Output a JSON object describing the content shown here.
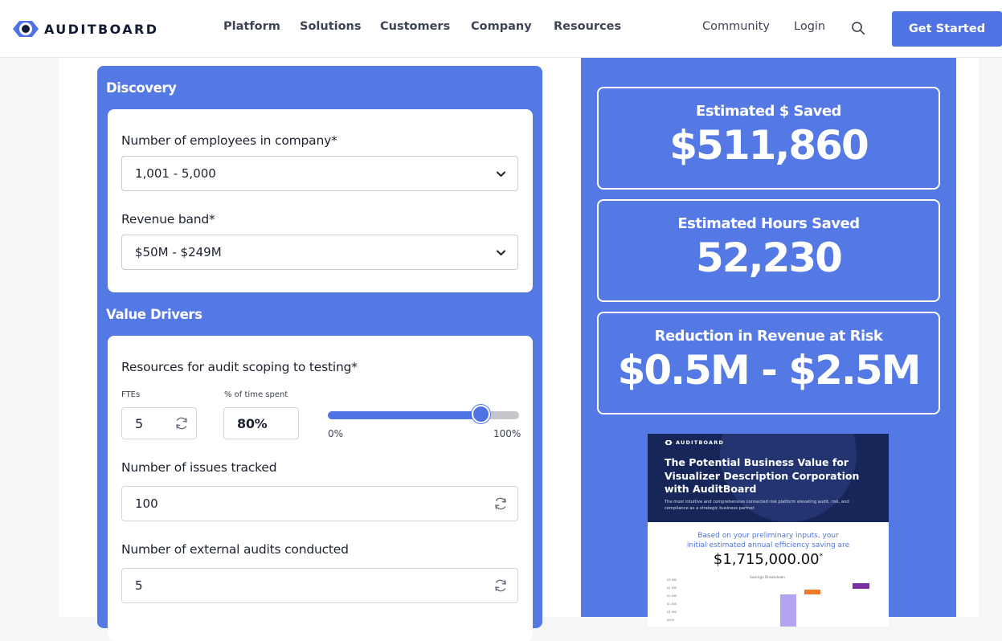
{
  "nav": {
    "logo_text": "AUDITBOARD",
    "links": [
      "Platform",
      "Solutions",
      "Customers",
      "Company",
      "Resources"
    ],
    "community": "Community",
    "login": "Login",
    "cta": "Get Started",
    "brand_color": "#4f73e3"
  },
  "discovery": {
    "title": "Discovery",
    "employees_label": "Number of employees in company*",
    "employees_value": "1,001 - 5,000",
    "revenue_label": "Revenue band*",
    "revenue_value": "$50M - $249M"
  },
  "value_drivers": {
    "title": "Value Drivers",
    "resources_label": "Resources for audit scoping to testing*",
    "ftes_label": "FTEs",
    "ftes_value": "5",
    "pct_label": "% of time spent",
    "pct_value": "80%",
    "slider_fraction": 0.8,
    "slider_min": "0%",
    "slider_max": "100%",
    "issues_label": "Number of issues tracked",
    "issues_value": "100",
    "audits_label": "Number of external audits conducted",
    "audits_value": "5"
  },
  "results": {
    "dollars_label": "Estimated $ Saved",
    "dollars_value": "$511,860",
    "hours_label": "Estimated Hours Saved",
    "hours_value": "52,230",
    "risk_label": "Reduction in Revenue at Risk",
    "risk_value": "$0.5M - $2.5M"
  },
  "report": {
    "logo_text": "AUDITBOARD",
    "title": "The Potential Business Value for Visualizer Description Corporation with AuditBoard",
    "description": "The most intuitive and comprehensive connected risk platform elevating audit, risk, and compliance as a strategic business partner.",
    "sub_line1": "Based on your preliminary inputs, your",
    "sub_line2": "initial estimated annual efficiency saving are",
    "amount": "$1,715,000.00",
    "amount_mark": "*",
    "chart_caption": "Savings Breakdown"
  }
}
